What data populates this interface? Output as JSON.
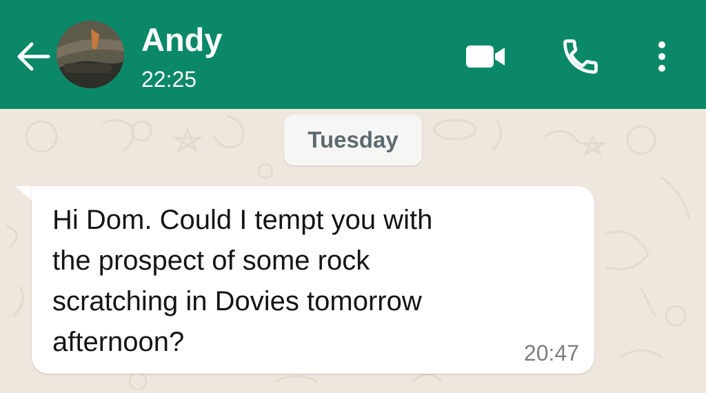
{
  "header": {
    "contact_name": "Andy",
    "status": "22:25",
    "color": "#0b8868",
    "icons": {
      "back": "arrow-left-icon",
      "video": "video-camera-icon",
      "call": "phone-icon",
      "menu": "more-vertical-icon"
    }
  },
  "chat": {
    "background_color": "#efe7de",
    "date_divider": "Tuesday",
    "messages": [
      {
        "direction": "incoming",
        "text": "Hi Dom. Could I tempt you with\nthe prospect of some rock\nscratching in Dovies  tomorrow\nafternoon?",
        "time": "20:47"
      }
    ]
  }
}
